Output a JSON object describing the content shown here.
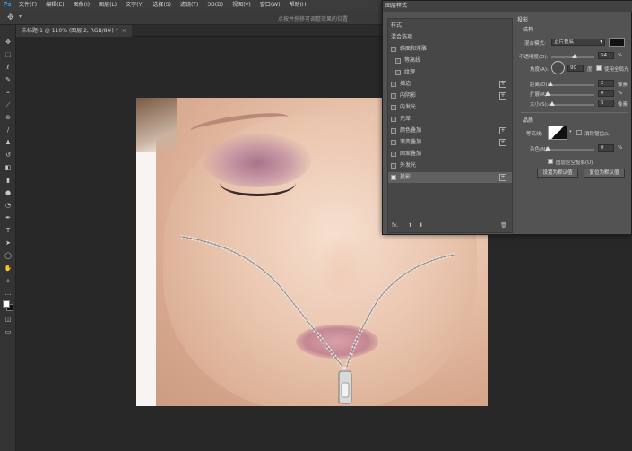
{
  "app": {
    "logo": "Ps"
  },
  "menu": [
    "文件(F)",
    "编辑(E)",
    "图像(I)",
    "图层(L)",
    "文字(Y)",
    "选择(S)",
    "滤镜(T)",
    "3D(D)",
    "视图(V)",
    "窗口(W)",
    "帮助(H)"
  ],
  "options_bar": {
    "tool_dropdown": "▾",
    "hint": "点按并拖移可调整效果的位置"
  },
  "document": {
    "tab_label": "未标题-1 @ 110% (图层 2, RGB/8#) *",
    "close": "×"
  },
  "dialog": {
    "title": "图层样式",
    "list_header": "样式",
    "blend_options": "混合选项",
    "effects": [
      {
        "label": "斜面和浮雕",
        "checked": false,
        "plus": false,
        "indent": false
      },
      {
        "label": "等高线",
        "checked": false,
        "plus": false,
        "indent": true
      },
      {
        "label": "纹理",
        "checked": false,
        "plus": false,
        "indent": true
      },
      {
        "label": "描边",
        "checked": false,
        "plus": true,
        "indent": false
      },
      {
        "label": "内阴影",
        "checked": false,
        "plus": true,
        "indent": false
      },
      {
        "label": "内发光",
        "checked": false,
        "plus": false,
        "indent": false
      },
      {
        "label": "光泽",
        "checked": false,
        "plus": false,
        "indent": false
      },
      {
        "label": "颜色叠加",
        "checked": false,
        "plus": true,
        "indent": false
      },
      {
        "label": "渐变叠加",
        "checked": false,
        "plus": true,
        "indent": false
      },
      {
        "label": "图案叠加",
        "checked": false,
        "plus": false,
        "indent": false
      },
      {
        "label": "外发光",
        "checked": false,
        "plus": false,
        "indent": false
      },
      {
        "label": "投影",
        "checked": true,
        "plus": true,
        "indent": false,
        "selected": true
      }
    ],
    "footer": {
      "fx": "fx.",
      "up": "⬆",
      "down": "⬇",
      "trash": "🗑"
    },
    "drop_shadow": {
      "section": "投影",
      "structure": "结构",
      "blend_mode_label": "混合模式:",
      "blend_mode_value": "正片叠底",
      "opacity_label": "不透明度(O):",
      "opacity_value": "54",
      "percent": "%",
      "angle_label": "角度(A):",
      "angle_value": "90",
      "degree": "度",
      "global_light": "使用全局光",
      "global_light_checked": true,
      "distance_label": "距离(D):",
      "distance_value": "2",
      "spread_label": "扩展(R):",
      "spread_value": "0",
      "size_label": "大小(S):",
      "size_value": "5",
      "px": "像素",
      "quality": "品质",
      "contour_label": "等高线:",
      "anti_alias": "消除锯齿(L)",
      "noise_label": "杂色(N):",
      "noise_value": "0",
      "knockout": "图层挖空投影(U)",
      "knockout_checked": true,
      "make_default": "设置为默认值",
      "reset_default": "复位为默认值",
      "opacity_fraction": 0.54,
      "distance_fraction": 0.05,
      "spread_fraction": 0.0,
      "size_fraction": 0.1,
      "noise_fraction": 0.0
    }
  },
  "tools": [
    "move-icon",
    "marquee-icon",
    "lasso-icon",
    "quick-select-icon",
    "crop-icon",
    "eyedropper-icon",
    "healing-icon",
    "brush-icon",
    "stamp-icon",
    "history-brush-icon",
    "eraser-icon",
    "gradient-icon",
    "blur-icon",
    "dodge-icon",
    "pen-icon",
    "type-icon",
    "path-select-icon",
    "shape-icon",
    "hand-icon",
    "zoom-icon",
    "more-icon"
  ]
}
